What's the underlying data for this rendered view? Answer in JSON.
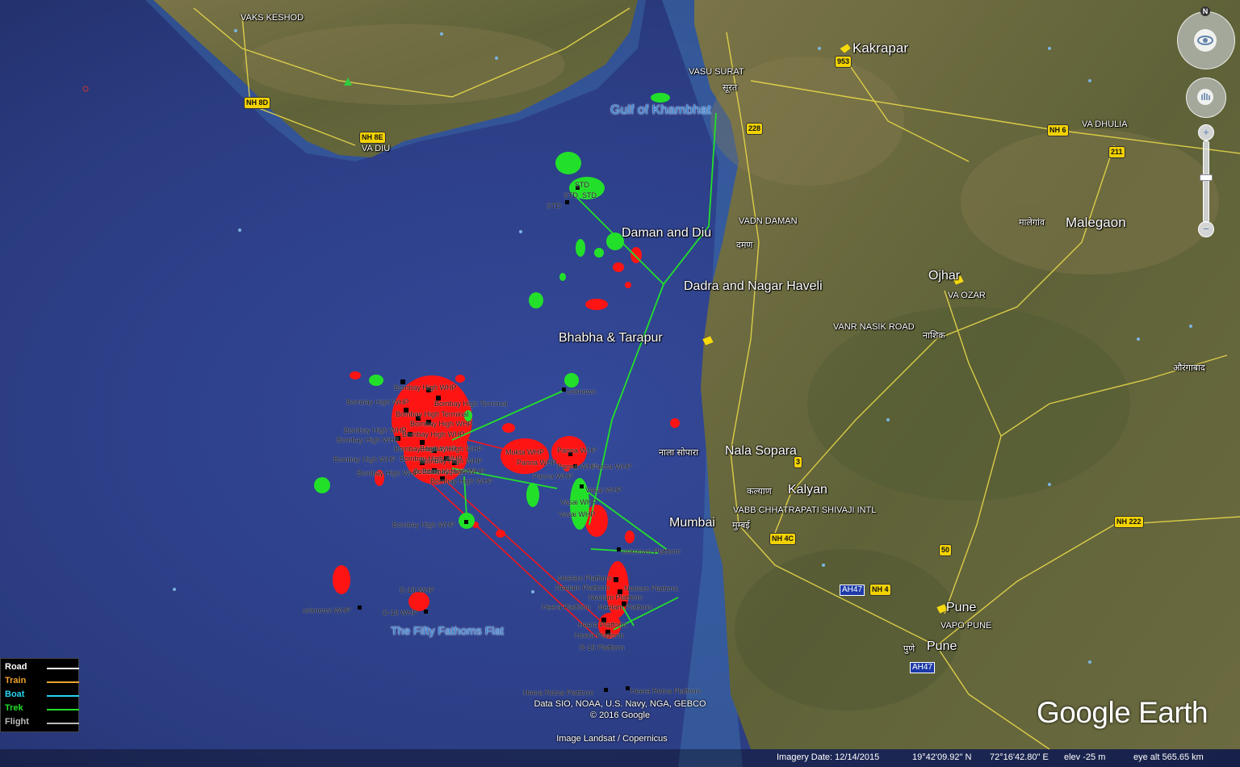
{
  "map": {
    "places": {
      "vaks_keshod": "VAKS KESHOD",
      "kakrapar": "Kakrapar",
      "vasu_surat": "VASU SURAT",
      "surat_hindi": "सूरत",
      "gulf": "Gulf of Khambhat",
      "va_dhulia": "VA DHULIA",
      "va_diu": "VA DIU",
      "vadn_daman": "VADN DAMAN",
      "daman_diu": "Daman and Diu",
      "daman_hindi": "दमण",
      "malegaon_hindi": "मालेगांव",
      "malegaon": "Malegaon",
      "dadra": "Dadra and Nagar Haveli",
      "ojhar": "Ojhar",
      "va_ozar": "VA OZAR",
      "vanr_nasik": "VANR NASIK ROAD",
      "nashik_hindi": "नाशिक",
      "bhabha": "Bhabha & Tarapur",
      "aurangabad_hindi": "औरंगाबाद",
      "nala_hindi": "नाला सोपारा",
      "nala": "Nala Sopara",
      "kalyan_hindi": "कल्याण",
      "kalyan": "Kalyan",
      "vabb": "VABB CHHATRAPATI SHIVAJI INTL",
      "mumbai": "Mumbai",
      "mumbai_hindi": "मुम्बई",
      "pune": "Pune",
      "vapo_pune": "VAPO PUNE",
      "pune_hindi": "पुणे",
      "pune2": "Pune",
      "fifty": "The Fifty Fathoms Flat"
    },
    "shields": {
      "nh8d": "NH 8D",
      "nh8e": "NH 8E",
      "nh953": "953",
      "nh228": "228",
      "nh6": "NH 6",
      "nh211": "211",
      "nh3": "3",
      "nh4c": "NH 4C",
      "nh50": "50",
      "nh222": "NH 222",
      "nh4": "NH 4",
      "ah47": "AH47",
      "ah47b": "AH47"
    },
    "platforms": {
      "std1": "STD",
      "std2": "STD",
      "std3": "STD",
      "std4": "STD",
      "bh1": "Bombay High WHP",
      "bh_terminal": "Bombay High Terminal",
      "bh2": "Bombay High WHP",
      "bh3": "Bombay High Terminal",
      "bh4": "Bombay High WHP",
      "bh5": "Bombay High WHP",
      "bh6": "Bombay High WHP",
      "bh7": "Bombay High WHP",
      "bh8": "Bombay High WHP",
      "bh9": "Bombay High WHP",
      "bh10": "Bombay High WHP",
      "bh11": "Bombay High WHP",
      "bh12": "Bombay High WHP",
      "bh13": "Bombay High WHP",
      "bh14": "Bombay High WHP",
      "bh15": "Bombay High WHP",
      "bh16": "Bombay High WHP",
      "bh_lower": "Bombay High WHP",
      "unknown1": "unknown",
      "mukta": "Mukta WHP",
      "panna1": "Panna WHP",
      "panna2": "Panna WHP",
      "panna3": "Panna WHP",
      "panna4": "Panna WHP",
      "panna5": "Panna WHP",
      "vasai1": "Vasai WHP",
      "vasai2": "Vasai WHP",
      "vasai3": "Vasai WHP",
      "unknown_platform": "unknown Platform",
      "neelam1": "Neelam Platform",
      "neelam2": "Neelam Platform",
      "neelam3": "Neelam Platform",
      "neelam4": "Neelam Platform",
      "neelam5": "Neelam Platform",
      "heera1": "Heera Platform",
      "heera2": "Heera Platform",
      "heera3": "Heera Platform",
      "r15": "R-15 Platform",
      "d18a": "D-18 WHP",
      "d18b": "D-18 WHP",
      "unknown_whp": "unknown WHP",
      "heera_retna1": "Heera Retna Platform",
      "heera_retna2": "Heera Retna Platform"
    }
  },
  "legend": [
    {
      "label": "Road",
      "color": "#ffffff"
    },
    {
      "label": "Train",
      "color": "#f0a22a"
    },
    {
      "label": "Boat",
      "color": "#26d4f0"
    },
    {
      "label": "Trek",
      "color": "#22e02a"
    },
    {
      "label": "Flight",
      "color": "#bbbbbb"
    }
  ],
  "credits": {
    "data": "Data SIO, NOAA, U.S. Navy, NGA, GEBCO",
    "copyright": "© 2016 Google",
    "imagery": "Image Landsat / Copernicus"
  },
  "brand": "Google Earth",
  "status": {
    "imagery_date": "Imagery Date: 12/14/2015",
    "lat": "19°42'09.92\" N",
    "lon": "72°16'42.80\" E",
    "elev": "elev   -25 m",
    "eye_alt": "eye alt 565.65 km"
  },
  "nav": {
    "north": "N",
    "zoom_in": "+",
    "zoom_out": "−"
  },
  "colors": {
    "ocean": "#2d3f86",
    "land": "#6b6a3c",
    "oil_red": "#ff1414",
    "oil_green": "#22e02a",
    "road": "#e8d84a"
  }
}
